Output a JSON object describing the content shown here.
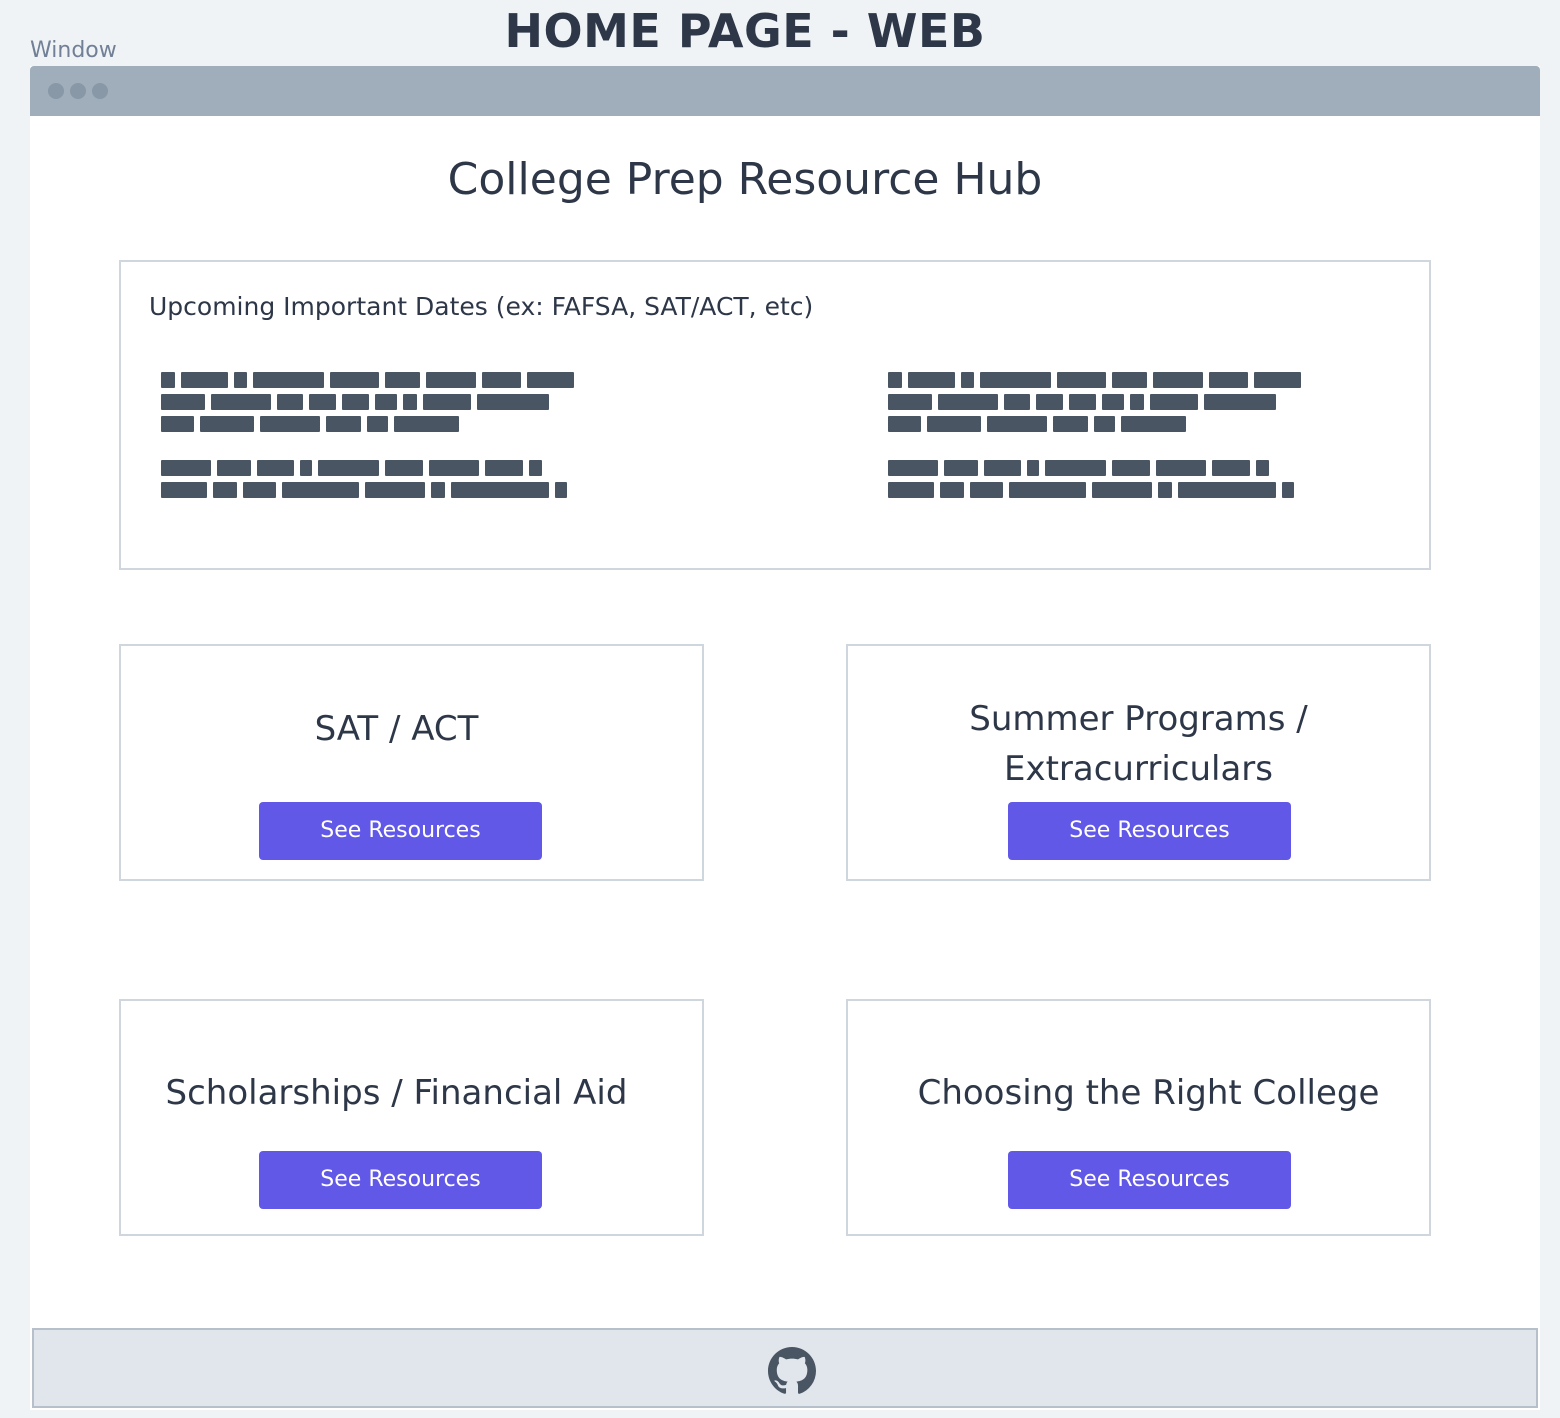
{
  "page_title": "HOME PAGE - WEB",
  "window_label": "Window",
  "hub_title": "College Prep Resource Hub",
  "dates": {
    "heading": "Upcoming Important Dates (ex: FAFSA, SAT/ACT, etc)"
  },
  "cards": [
    {
      "title": "SAT / ACT",
      "button": "See Resources"
    },
    {
      "title": "Summer Programs / Extracurriculars",
      "button": "See Resources"
    },
    {
      "title": "Scholarships / Financial Aid",
      "button": "See Resources"
    },
    {
      "title": "Choosing the Right College",
      "button": "See Resources"
    }
  ],
  "footer": {
    "icon": "github-icon"
  },
  "colors": {
    "accent": "#6158e8",
    "titlebar": "#a0aebb",
    "footer_bg": "#e1e6ed",
    "redacted_text": "#4a5563"
  }
}
